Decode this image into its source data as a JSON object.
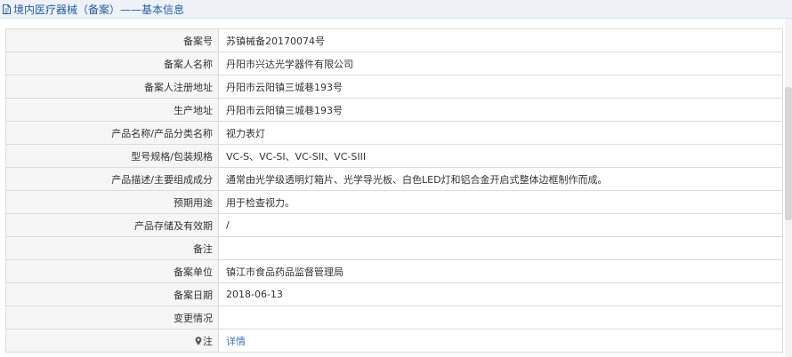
{
  "header": {
    "title": "境内医疗器械（备案）——基本信息"
  },
  "rows": [
    {
      "label": "备案号",
      "value": "苏镇械备20170074号"
    },
    {
      "label": "备案人名称",
      "value": "丹阳市兴达光学器件有限公司"
    },
    {
      "label": "备案人注册地址",
      "value": "丹阳市云阳镇三城巷193号"
    },
    {
      "label": "生产地址",
      "value": "丹阳市云阳镇三城巷193号"
    },
    {
      "label": "产品名称/产品分类名称",
      "value": "视力表灯"
    },
    {
      "label": "型号规格/包装规格",
      "value": "VC-S、VC-SI、VC-SII、VC-SIII"
    },
    {
      "label": "产品描述/主要组成成分",
      "value": "通常由光学级透明灯箱片、光学导光板、白色LED灯和铝合金开启式整体边框制作而成。"
    },
    {
      "label": "预期用途",
      "value": "用于检查视力。"
    },
    {
      "label": "产品存储及有效期",
      "value": "/"
    },
    {
      "label": "备注",
      "value": ""
    },
    {
      "label": "备案单位",
      "value": "镇江市食品药品监督管理局"
    },
    {
      "label": "备案日期",
      "value": "2018-06-13"
    },
    {
      "label": "变更情况",
      "value": ""
    }
  ],
  "note": {
    "icon": "pin-icon",
    "label": "注",
    "link_text": "详情"
  },
  "colors": {
    "title": "#1f5fa5",
    "link": "#3a79c4",
    "label_bg": "#f5f5f5",
    "border": "#dcdcdc"
  }
}
